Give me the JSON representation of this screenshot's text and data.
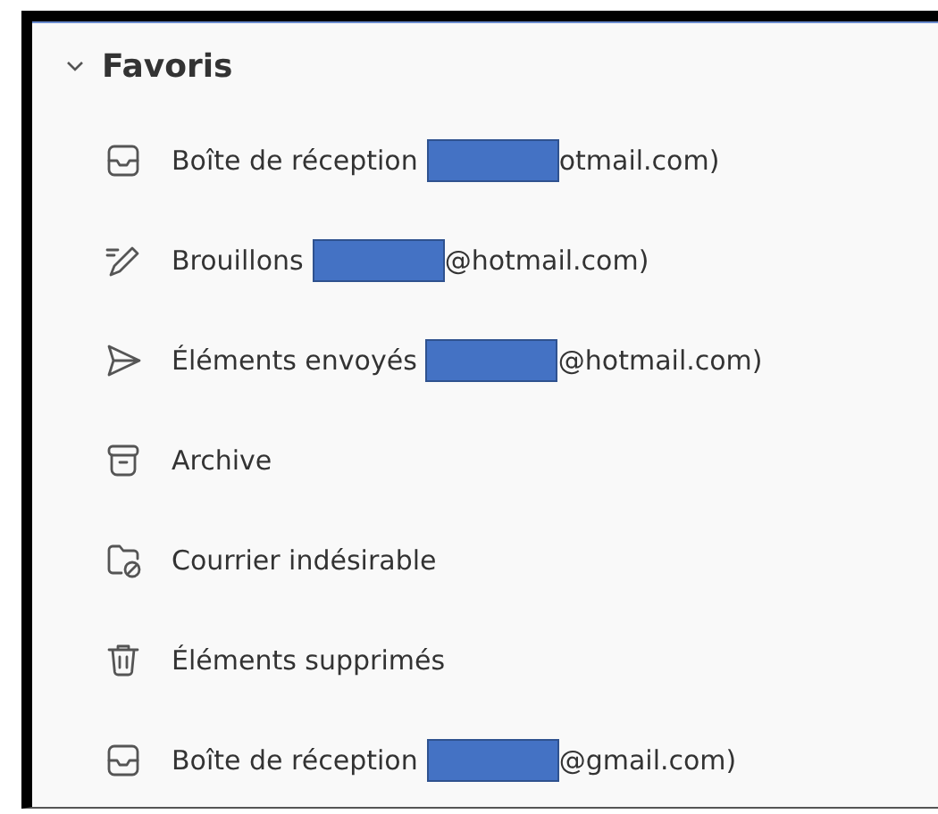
{
  "section": {
    "title": "Favoris",
    "expanded": true
  },
  "folders": [
    {
      "kind": "inbox",
      "label": "Boîte de réception",
      "redacted": true,
      "suffix": "otmail.com)"
    },
    {
      "kind": "drafts",
      "label": "Brouillons",
      "redacted": true,
      "suffix": "@hotmail.com)"
    },
    {
      "kind": "sent",
      "label": "Éléments envoyés",
      "redacted": true,
      "suffix": "@hotmail.com)"
    },
    {
      "kind": "archive",
      "label": "Archive",
      "redacted": false
    },
    {
      "kind": "junk",
      "label": "Courrier indésirable",
      "redacted": false
    },
    {
      "kind": "trash",
      "label": "Éléments supprimés",
      "redacted": false
    },
    {
      "kind": "inbox",
      "label": "Boîte de réception",
      "redacted": true,
      "suffix": "@gmail.com)"
    }
  ]
}
